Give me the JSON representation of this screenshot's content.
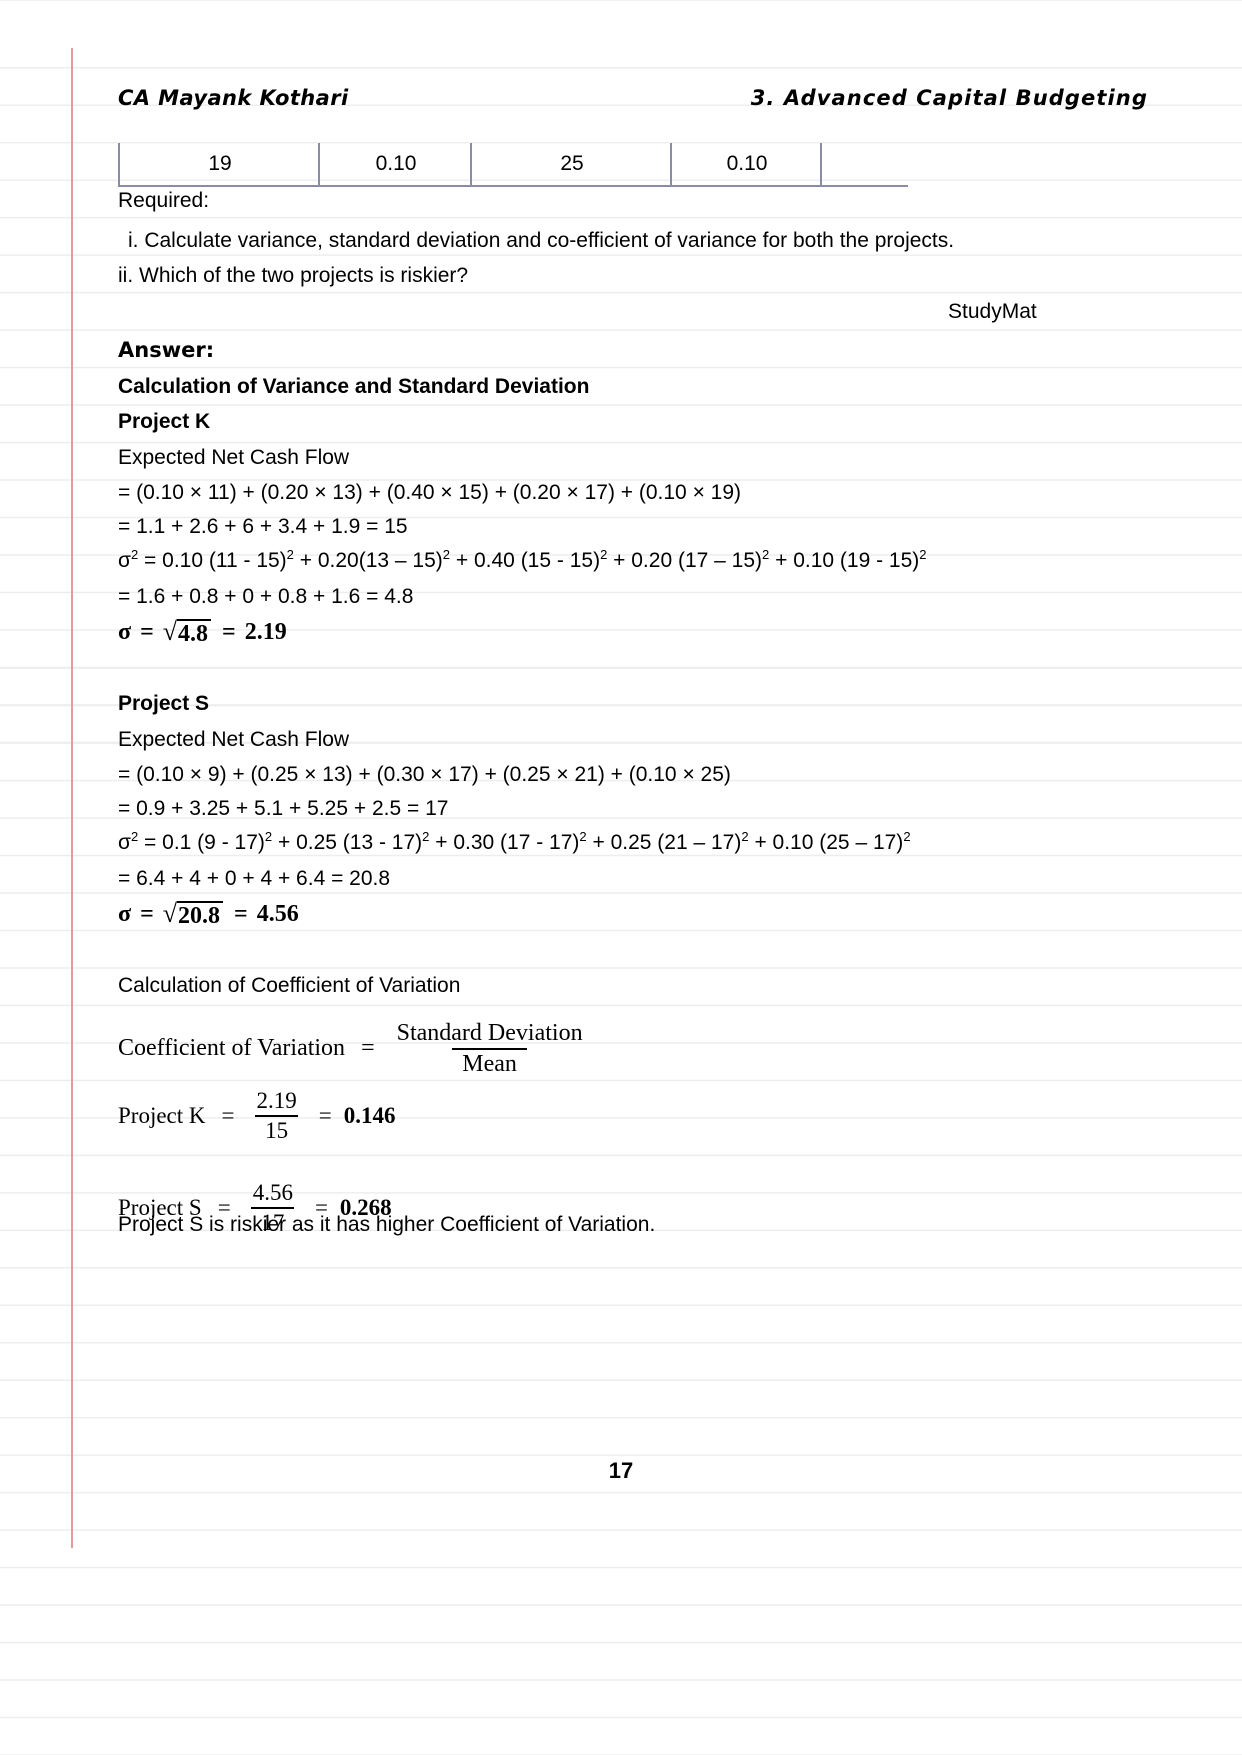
{
  "header": {
    "left": "CA Mayank Kothari",
    "right": "3. Advanced Capital Budgeting"
  },
  "table_fragment": {
    "cells": [
      "19",
      "0.10",
      "25",
      "0.10"
    ]
  },
  "body": {
    "required_label": "Required:",
    "requirement_i": "i. Calculate variance, standard deviation and co-efficient of variance for both the projects.",
    "requirement_ii": "ii. Which of the two projects is riskier?",
    "source_note": "StudyMat",
    "answer_label": "Answer:",
    "section_title": "Calculation of Variance and Standard Deviation",
    "project_k": {
      "title": "Project K",
      "encf_label": "Expected Net Cash Flow",
      "encf_expr": "= (0.10 × 11) + (0.20 × 13) + (0.40 × 15) + (0.20 × 17) + (0.10 × 19)",
      "encf_result": "= 1.1 + 2.6 + 6 + 3.4 + 1.9 = 15",
      "variance_expr_prefix": "σ",
      "variance_expr_sup": "2",
      "variance_expr": " = 0.10 (11 - 15)",
      "variance_result": "= 1.6 + 0.8 + 0 + 0.8 + 1.6 = 4.8",
      "sigma_symbol": "σ",
      "sigma_radicand": "4.8",
      "sigma_value": "2.19",
      "variance_terms": [
        {
          "coef": "0.10 ",
          "paren": "(11 - 15)"
        },
        {
          "coef": "0.20",
          "paren": "(13 – 15)"
        },
        {
          "coef": "0.40 ",
          "paren": "(15 - 15)"
        },
        {
          "coef": "0.20 ",
          "paren": "(17 – 15)"
        },
        {
          "coef": "0.10 ",
          "paren": "(19 - 15)"
        }
      ]
    },
    "project_s": {
      "title": "Project S",
      "encf_label": "Expected Net Cash Flow",
      "encf_expr": "= (0.10 × 9) + (0.25 × 13) + (0.30 × 17) + (0.25 × 21) + (0.10 × 25)",
      "encf_result": "= 0.9 + 3.25 + 5.1 + 5.25 + 2.5 = 17",
      "variance_result": "= 6.4 + 4 + 0 + 4 + 6.4 = 20.8",
      "sigma_symbol": "σ",
      "sigma_radicand": "20.8",
      "sigma_value": "4.56",
      "variance_terms": [
        {
          "coef": "0.1 ",
          "paren": "(9 - 17)"
        },
        {
          "coef": "0.25 ",
          "paren": "(13 - 17)"
        },
        {
          "coef": "0.30 ",
          "paren": "(17 - 17)"
        },
        {
          "coef": "0.25 ",
          "paren": "(21 – 17)"
        },
        {
          "coef": "0.10 ",
          "paren": "(25 – 17)"
        }
      ]
    },
    "cov": {
      "heading": "Calculation of Coefficient of Variation",
      "formula_label": "Coefficient of Variation",
      "formula_eq": "=",
      "formula_num": "Standard Deviation",
      "formula_den": "Mean",
      "rows": [
        {
          "label": "Project K",
          "eq": "=",
          "num": "2.19",
          "den": "15",
          "eq2": "=",
          "result": "0.146"
        },
        {
          "label": "Project S",
          "eq": "=",
          "num": "4.56",
          "den": "17",
          "eq2": "=",
          "result": "0.268"
        }
      ],
      "conclusion": "Project S is riskier as it has higher Coefficient of Variation."
    }
  },
  "footer": {
    "page_number": "17"
  },
  "colors": {
    "margin_rule": "#e79a9c",
    "ruled_line": "#ededee",
    "table_border": "#8b8ba6",
    "text": "#000000"
  }
}
